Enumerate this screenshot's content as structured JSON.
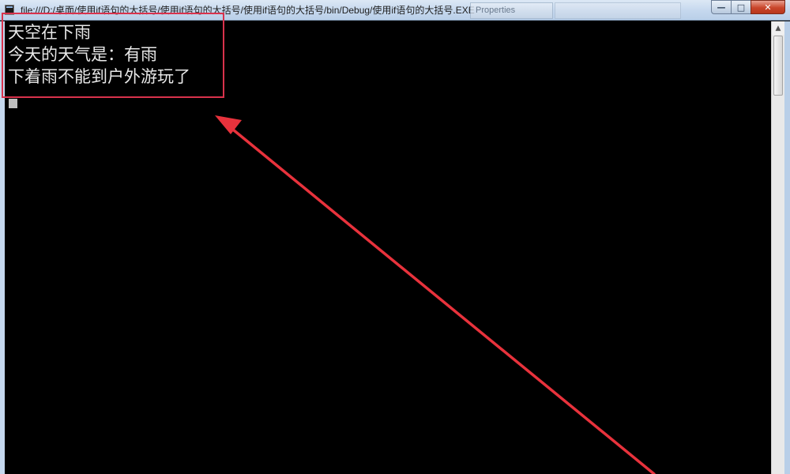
{
  "window": {
    "title": "file:///D:/桌面/使用if语句的大括号/使用if语句的大括号/使用if语句的大括号/bin/Debug/使用if语句的大括号.EXE",
    "background_tab": "Properties",
    "controls": {
      "minimize_icon": "minimize-icon",
      "maximize_icon": "maximize-icon",
      "close_icon": "close-icon"
    }
  },
  "console": {
    "lines": [
      "天空在下雨",
      "今天的天气是：有雨",
      "下着雨不能到户外游玩了"
    ],
    "text_color": "#e8e8e8",
    "background": "#000000"
  },
  "annotation": {
    "box_color": "#d9324c",
    "arrow_color": "#e8323c"
  }
}
